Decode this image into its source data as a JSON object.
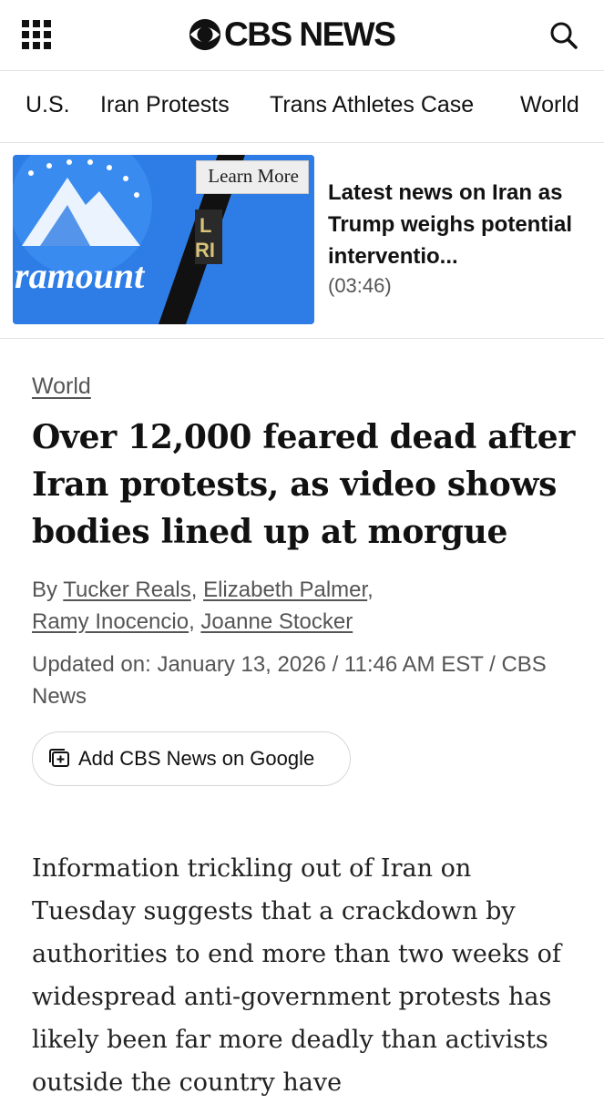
{
  "header": {
    "brand": "CBS NEWS",
    "icons": {
      "menu": "grid-menu-icon",
      "search": "search-icon",
      "logo": "cbs-eye-logo-icon"
    }
  },
  "nav": {
    "items": [
      "U.S.",
      "Iran Protests",
      "Trans Athletes Case",
      "World"
    ]
  },
  "promo": {
    "learn_more": "Learn More",
    "title": "Latest news on Iran as Trump weighs potential interventio...",
    "duration": "(03:46)",
    "thumb_text": "ramount"
  },
  "article": {
    "category": "World",
    "headline": "Over 12,000 feared dead after Iran protests, as video shows bodies lined up at morgue",
    "byline_prefix": "By",
    "authors": [
      "Tucker Reals",
      "Elizabeth Palmer",
      "Ramy Inocencio",
      "Joanne Stocker"
    ],
    "updated": "Updated on: January 13, 2026 / 11:46 AM EST / CBS News",
    "google_button": "Add CBS News on Google",
    "body": "Information trickling out of Iran on Tuesday suggests that a crackdown by authorities to end more than two weeks of widespread anti-government protests has likely been far more deadly than activists outside the country have"
  },
  "colors": {
    "text": "#111111",
    "muted": "#555555",
    "divider": "#e2e2e2",
    "thumb_blue": "#2e7de6"
  }
}
